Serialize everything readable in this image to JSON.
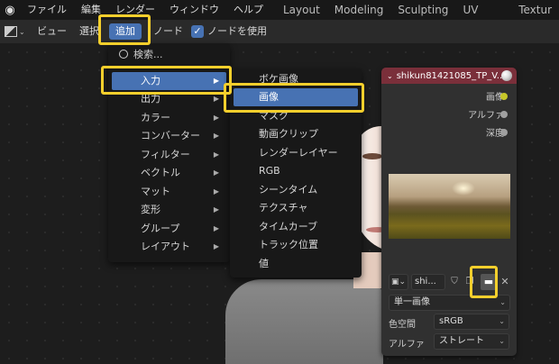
{
  "topbar": {
    "menu": [
      "ファイル",
      "編集",
      "レンダー",
      "ウィンドウ",
      "ヘルプ"
    ],
    "workspaces": [
      "Layout",
      "Modeling",
      "Sculpting",
      "UV Editing",
      "Textur"
    ]
  },
  "header": {
    "view": "ビュー",
    "select": "選択",
    "add": "追加",
    "node": "ノード",
    "use_nodes": "ノードを使用"
  },
  "add_menu": {
    "search": "検索...",
    "items": [
      "入力",
      "出力",
      "カラー",
      "コンバーター",
      "フィルター",
      "ベクトル",
      "マット",
      "変形",
      "グループ",
      "レイアウト"
    ]
  },
  "input_menu": {
    "items": [
      "ボケ画像",
      "画像",
      "マスク",
      "動画クリップ",
      "レンダーレイヤー",
      "RGB",
      "シーンタイム",
      "テクスチャ",
      "タイムカーブ",
      "トラック位置",
      "値"
    ]
  },
  "node": {
    "title": "shikun81421085_TP_V...",
    "outputs": [
      "画像",
      "アルファ",
      "深度"
    ],
    "image_name": "shi...",
    "source": "単一画像",
    "colorspace_label": "色空間",
    "colorspace": "sRGB",
    "alpha_label": "アルファ",
    "alpha": "ストレート"
  },
  "colors": {
    "accent": "#4772b3",
    "highlight": "#f5cf2c",
    "node_header": "#7a2f3a"
  }
}
